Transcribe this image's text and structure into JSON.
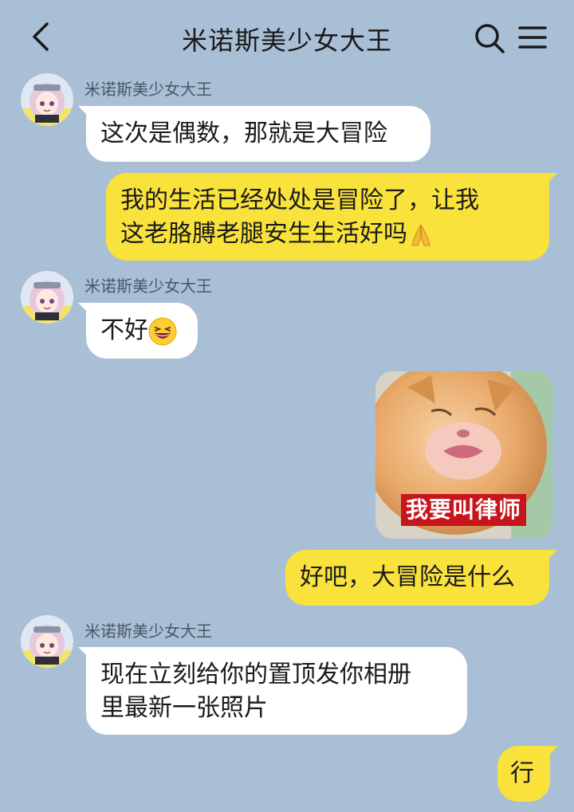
{
  "header": {
    "title": "米诺斯美少女大王",
    "back_icon": "chevron-left-icon",
    "search_icon": "search-icon",
    "menu_icon": "menu-icon"
  },
  "colors": {
    "background": "#a9bfd6",
    "incoming_bubble": "#ffffff",
    "outgoing_bubble": "#f9e23b",
    "sticker_caption_bg": "#c8141c"
  },
  "messages": [
    {
      "direction": "in",
      "sender": "米诺斯美少女大王",
      "text": "这次是偶数，那就是大冒险"
    },
    {
      "direction": "out",
      "line1": "我的生活已经处处是冒险了，让我",
      "line2": "这老胳膊老腿安生生活好吗",
      "emoji": "folded-hands-emoji"
    },
    {
      "direction": "in",
      "sender": "米诺斯美少女大王",
      "text": "不好",
      "emoji": "grinning-squinting-face-emoji"
    },
    {
      "direction": "out",
      "type": "sticker",
      "caption": "我要叫律师",
      "image": "cat-sticker-image"
    },
    {
      "direction": "out",
      "text": "好吧，大冒险是什么"
    },
    {
      "direction": "in",
      "sender": "米诺斯美少女大王",
      "line1": "现在立刻给你的置顶发你相册",
      "line2": "里最新一张照片"
    },
    {
      "direction": "out",
      "text": "行"
    }
  ]
}
